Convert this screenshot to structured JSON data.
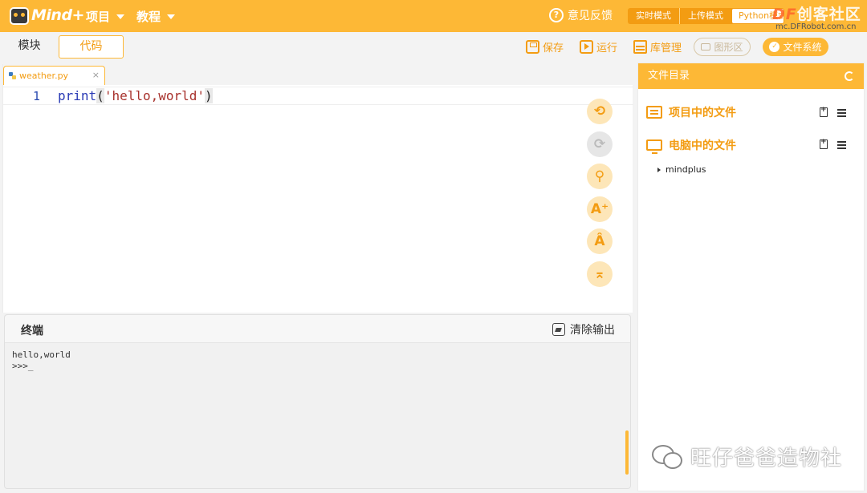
{
  "app": {
    "logo_text": "Mind+",
    "menus": [
      {
        "label": "项目"
      },
      {
        "label": "教程"
      }
    ],
    "feedback_label": "意见反馈",
    "modes": [
      "实时模式",
      "上传模式",
      "Python模式"
    ],
    "active_mode": "Python模式"
  },
  "watermarks": {
    "brand_df": "DF",
    "brand_text": "创客社区",
    "url": "mc.DFRobot.com.cn",
    "bottom": "旺仔爸爸造物社"
  },
  "toolbar": {
    "tab_blocks": "模块",
    "tab_code": "代码",
    "save": "保存",
    "run": "运行",
    "library": "库管理",
    "graphics": "图形区",
    "file_system": "文件系统"
  },
  "editor": {
    "file_tab": "weather.py",
    "close_symbol": "×",
    "lines": [
      {
        "num": "1",
        "fn": "print",
        "open": "(",
        "arg": "'hello,world'",
        "close": ")"
      }
    ],
    "side_tools": [
      "undo-icon",
      "redo-icon",
      "search-icon",
      "font-increase-icon",
      "font-decrease-icon",
      "collapse-icon"
    ]
  },
  "terminal": {
    "title": "终端",
    "clear_label": "清除输出",
    "output": "hello,world\n>>>_"
  },
  "file_panel": {
    "title": "文件目录",
    "sections": [
      {
        "label": "项目中的文件",
        "icon": "list-icon"
      },
      {
        "label": "电脑中的文件",
        "icon": "monitor-icon"
      }
    ],
    "tree": [
      {
        "label": "mindplus",
        "expanded": false
      }
    ]
  },
  "colors": {
    "accent": "#fdb836",
    "accent_dark": "#f39c12"
  }
}
